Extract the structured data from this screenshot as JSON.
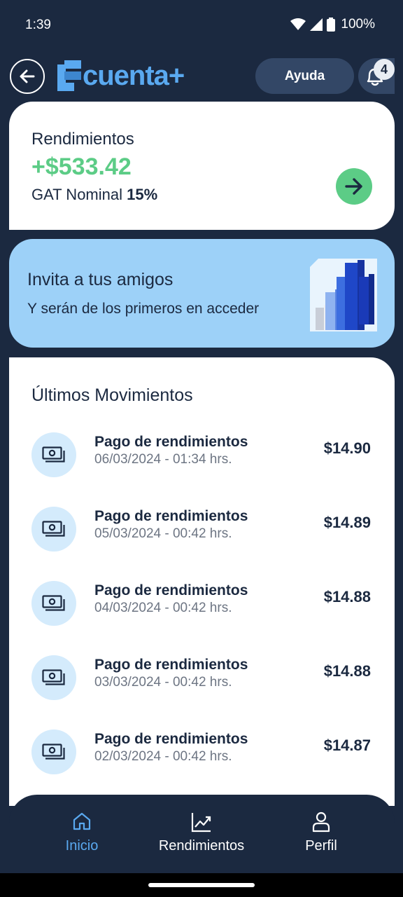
{
  "status_bar": {
    "time": "1:39",
    "battery": "100%"
  },
  "header": {
    "logo_text": "cuenta+",
    "help_label": "Ayuda",
    "notification_count": "4"
  },
  "earnings": {
    "title": "Rendimientos",
    "amount": "+$533.42",
    "gat_label": "GAT Nominal",
    "gat_value": "15%"
  },
  "invite": {
    "title": "Invita a tus amigos",
    "subtitle": "Y serán de los primeros en acceder"
  },
  "movements": {
    "title": "Últimos Movimientos",
    "items": [
      {
        "title": "Pago de rendimientos",
        "date": "06/03/2024 - 01:34 hrs.",
        "amount": "$14.90"
      },
      {
        "title": "Pago de rendimientos",
        "date": "05/03/2024 - 00:42 hrs.",
        "amount": "$14.89"
      },
      {
        "title": "Pago de rendimientos",
        "date": "04/03/2024 - 00:42 hrs.",
        "amount": "$14.88"
      },
      {
        "title": "Pago de rendimientos",
        "date": "03/03/2024 - 00:42 hrs.",
        "amount": "$14.88"
      },
      {
        "title": "Pago de rendimientos",
        "date": "02/03/2024 - 00:42 hrs.",
        "amount": "$14.87"
      }
    ]
  },
  "nav": {
    "items": [
      {
        "label": "Inicio",
        "icon": "home-icon",
        "active": true
      },
      {
        "label": "Rendimientos",
        "icon": "chart-icon",
        "active": false
      },
      {
        "label": "Perfil",
        "icon": "user-icon",
        "active": false
      }
    ]
  },
  "colors": {
    "background": "#1b2940",
    "accent_blue": "#5aa9f0",
    "positive_green": "#5ccc86",
    "banner_blue": "#9dd1f8"
  }
}
